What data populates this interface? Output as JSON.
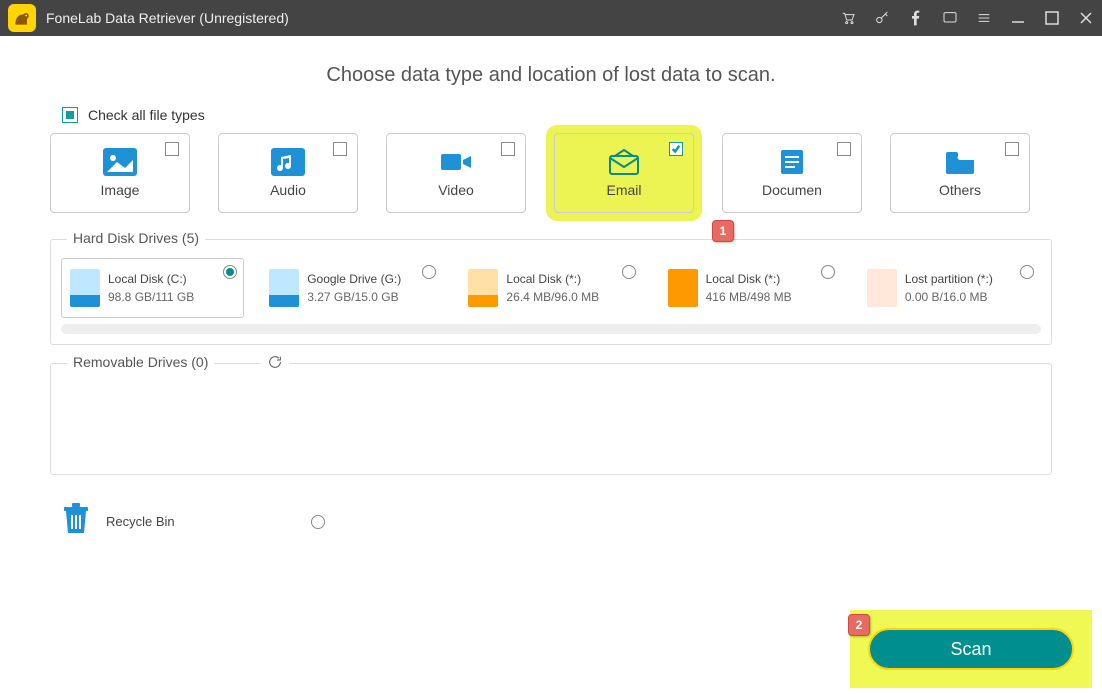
{
  "window": {
    "title": "FoneLab Data Retriever (Unregistered)"
  },
  "heading": "Choose data type and location of lost data to scan.",
  "check_all_label": "Check all file types",
  "types": {
    "image": {
      "label": "Image",
      "checked": false
    },
    "audio": {
      "label": "Audio",
      "checked": false
    },
    "video": {
      "label": "Video",
      "checked": false
    },
    "email": {
      "label": "Email",
      "checked": true
    },
    "document": {
      "label": "Documen",
      "checked": false
    },
    "others": {
      "label": "Others",
      "checked": false
    }
  },
  "hard_disk": {
    "label": "Hard Disk Drives (5)",
    "items": [
      {
        "name": "Local Disk (C:)",
        "size": "98.8 GB/111 GB",
        "topColor": "#bfe7ff",
        "botColor": "#1f91d6",
        "selected": true
      },
      {
        "name": "Google Drive (G:)",
        "size": "3.27 GB/15.0 GB",
        "topColor": "#bfe7ff",
        "botColor": "#1f91d6",
        "selected": false
      },
      {
        "name": "Local Disk (*:)",
        "size": "26.4 MB/96.0 MB",
        "topColor": "#ffe1a8",
        "botColor": "#ff9900",
        "selected": false
      },
      {
        "name": "Local Disk (*:)",
        "size": "416 MB/498 MB",
        "topColor": "#ff9900",
        "botColor": "#ff9900",
        "selected": false
      },
      {
        "name": "Lost partition (*:)",
        "size": "0.00 B/16.0 MB",
        "topColor": "#ffe8da",
        "botColor": "#ffe8da",
        "selected": false
      }
    ]
  },
  "removable": {
    "label": "Removable Drives (0)"
  },
  "recycle": {
    "label": "Recycle Bin"
  },
  "scan_label": "Scan",
  "badges": {
    "one": "1",
    "two": "2"
  }
}
